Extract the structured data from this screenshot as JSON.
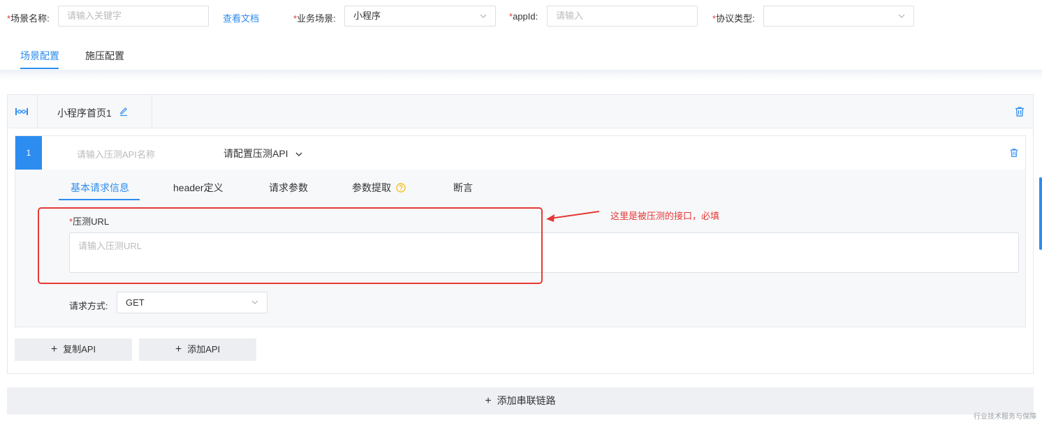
{
  "form": {
    "scene_name": {
      "required": "*",
      "label": "场景名称:",
      "placeholder": "请输入关键字"
    },
    "doc_link": "查看文档",
    "business_scene": {
      "required": "*",
      "label": "业务场景:",
      "value": "小程序"
    },
    "appid": {
      "required": "*",
      "label": "appId:",
      "placeholder": "请输入"
    },
    "protocol": {
      "required": "*",
      "label": "协议类型:",
      "value": ""
    }
  },
  "top_tabs": [
    {
      "label": "场景配置",
      "active": true
    },
    {
      "label": "施压配置",
      "active": false
    }
  ],
  "chain_card": {
    "title": "小程序首页1",
    "api": {
      "index": "1",
      "name_placeholder": "请输入压测API名称",
      "config_label": "请配置压测API",
      "tabs": [
        {
          "label": "基本请求信息",
          "active": true
        },
        {
          "label": "header定义",
          "active": false
        },
        {
          "label": "请求参数",
          "active": false
        },
        {
          "label": "参数提取",
          "active": false,
          "help_icon": "question-circle-icon"
        },
        {
          "label": "断言",
          "active": false
        }
      ],
      "url_field": {
        "required": "*",
        "label": "压测URL",
        "placeholder": "请输入压测URL"
      },
      "method_field": {
        "label": "请求方式:",
        "value": "GET"
      }
    },
    "buttons": {
      "copy_api": "复制API",
      "add_api": "添加API"
    }
  },
  "add_chain_label": "添加串联链路",
  "annotation": "这里是被压测的接口，必填",
  "watermark": "行业技术服务与保障",
  "colors": {
    "accent": "#2d8cf0",
    "annotation": "#e53935"
  }
}
